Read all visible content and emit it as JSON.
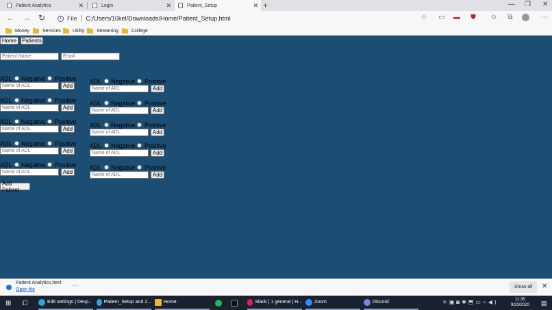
{
  "browser": {
    "tabs": [
      {
        "title": "Patient Analytics",
        "active": false
      },
      {
        "title": "Login",
        "active": false
      },
      {
        "title": "Patient_Setup",
        "active": true
      }
    ],
    "address": {
      "scheme_label": "File",
      "url": "C:/Users/10kel/Downloads/Home/Patient_Setup.html"
    },
    "bookmarks": [
      "Money",
      "Services",
      "Utility",
      "Streaming",
      "College"
    ]
  },
  "page": {
    "nav": {
      "home_label": "Home",
      "patients_label": "Patients"
    },
    "patient_name_placeholder": "Patient Name",
    "email_placeholder": "Email",
    "adl": {
      "label": "ADL",
      "negative_label": "Negative",
      "positive_label": "Positive",
      "input_placeholder": "Name of ADL",
      "add_label": "Add"
    },
    "add_patient_label": "Add Patient"
  },
  "downloads": {
    "file_name": "Patient Analytics.html",
    "open_label": "Open file",
    "show_all_label": "Show all"
  },
  "taskbar": {
    "items": [
      {
        "label": "Edit settings | Devp...",
        "color": "#2ea6d8"
      },
      {
        "label": "Patient_Setup and 2...",
        "color": "#2ea6d8"
      },
      {
        "label": "Home",
        "color": "#e8b830"
      },
      {
        "label": "",
        "color": "#1db954"
      },
      {
        "label": "",
        "color": "#222222"
      },
      {
        "label": "Slack | 1 general | H...",
        "color": "#e01e5a"
      },
      {
        "label": "Zoom",
        "color": "#2d8cff"
      },
      {
        "label": "Discord",
        "color": "#7289da"
      }
    ],
    "time": "11:35",
    "date": "9/20/2020"
  }
}
